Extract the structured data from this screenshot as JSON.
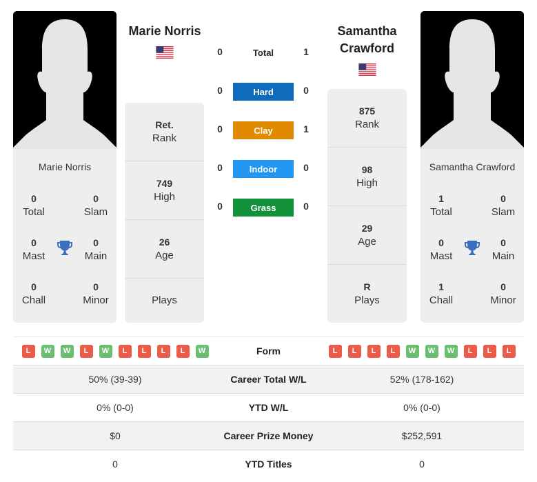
{
  "player1": {
    "name": "Marie Norris",
    "country_flag": "us-flag",
    "card": {
      "name": "Marie Norris",
      "stats": [
        {
          "value": "0",
          "label": "Total"
        },
        {
          "value": "0",
          "label": "Slam"
        },
        {
          "value": "0",
          "label": "Mast"
        },
        {
          "value": "0",
          "label": "Main"
        },
        {
          "value": "0",
          "label": "Chall"
        },
        {
          "value": "0",
          "label": "Minor"
        }
      ]
    },
    "info": [
      {
        "value": "Ret.",
        "label": "Rank"
      },
      {
        "value": "749",
        "label": "High"
      },
      {
        "value": "26",
        "label": "Age"
      },
      {
        "value": "",
        "label": "Plays"
      }
    ],
    "form": [
      "L",
      "W",
      "W",
      "L",
      "W",
      "L",
      "L",
      "L",
      "L",
      "W"
    ]
  },
  "player2": {
    "name": "Samantha Crawford",
    "name_line1": "Samantha",
    "name_line2": "Crawford",
    "country_flag": "us-flag",
    "card": {
      "name": "Samantha Crawford",
      "stats": [
        {
          "value": "1",
          "label": "Total"
        },
        {
          "value": "0",
          "label": "Slam"
        },
        {
          "value": "0",
          "label": "Mast"
        },
        {
          "value": "0",
          "label": "Main"
        },
        {
          "value": "1",
          "label": "Chall"
        },
        {
          "value": "0",
          "label": "Minor"
        }
      ]
    },
    "info": [
      {
        "value": "875",
        "label": "Rank"
      },
      {
        "value": "98",
        "label": "High"
      },
      {
        "value": "29",
        "label": "Age"
      },
      {
        "value": "R",
        "label": "Plays"
      }
    ],
    "form": [
      "L",
      "L",
      "L",
      "L",
      "W",
      "W",
      "W",
      "L",
      "L",
      "L"
    ]
  },
  "h2h": {
    "total": {
      "label": "Total",
      "p1": "0",
      "p2": "1"
    },
    "surfaces": [
      {
        "label": "Hard",
        "p1": "0",
        "p2": "0",
        "color": "#0f6cbd"
      },
      {
        "label": "Clay",
        "p1": "0",
        "p2": "1",
        "color": "#e08a00"
      },
      {
        "label": "Indoor",
        "p1": "0",
        "p2": "0",
        "color": "#2196f3"
      },
      {
        "label": "Grass",
        "p1": "0",
        "p2": "0",
        "color": "#12903a"
      }
    ]
  },
  "table": {
    "form_label": "Form",
    "rows": [
      {
        "label": "Career Total W/L",
        "p1": "50% (39-39)",
        "p2": "52% (178-162)"
      },
      {
        "label": "YTD W/L",
        "p1": "0% (0-0)",
        "p2": "0% (0-0)"
      },
      {
        "label": "Career Prize Money",
        "p1": "$0",
        "p2": "$252,591"
      },
      {
        "label": "YTD Titles",
        "p1": "0",
        "p2": "0"
      }
    ]
  },
  "colors": {
    "loss": "#ec5b47",
    "win": "#6cbf72",
    "trophy": "#3a6fbf"
  }
}
